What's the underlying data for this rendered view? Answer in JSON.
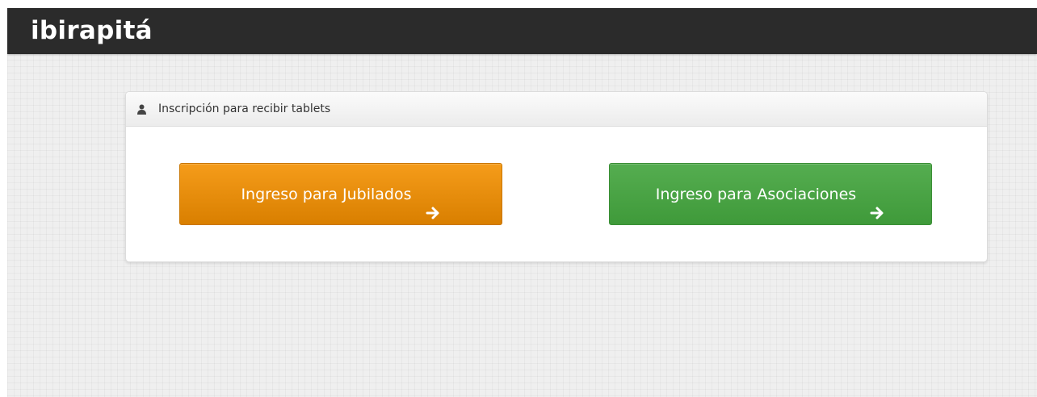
{
  "header": {
    "brand": "ibirapitá"
  },
  "panel": {
    "icon": "user-icon",
    "title": "Inscripción para recibir tablets"
  },
  "buttons": {
    "jubilados": {
      "label": "Ingreso para Jubilados",
      "icon": "arrow-right-icon",
      "color": "#f0900f"
    },
    "asociaciones": {
      "label": "Ingreso para Asociaciones",
      "icon": "arrow-right-icon",
      "color": "#4ca646"
    }
  },
  "colors": {
    "topbar": "#2b2b2b",
    "background": "#efefef",
    "panel_background": "#ffffff"
  }
}
